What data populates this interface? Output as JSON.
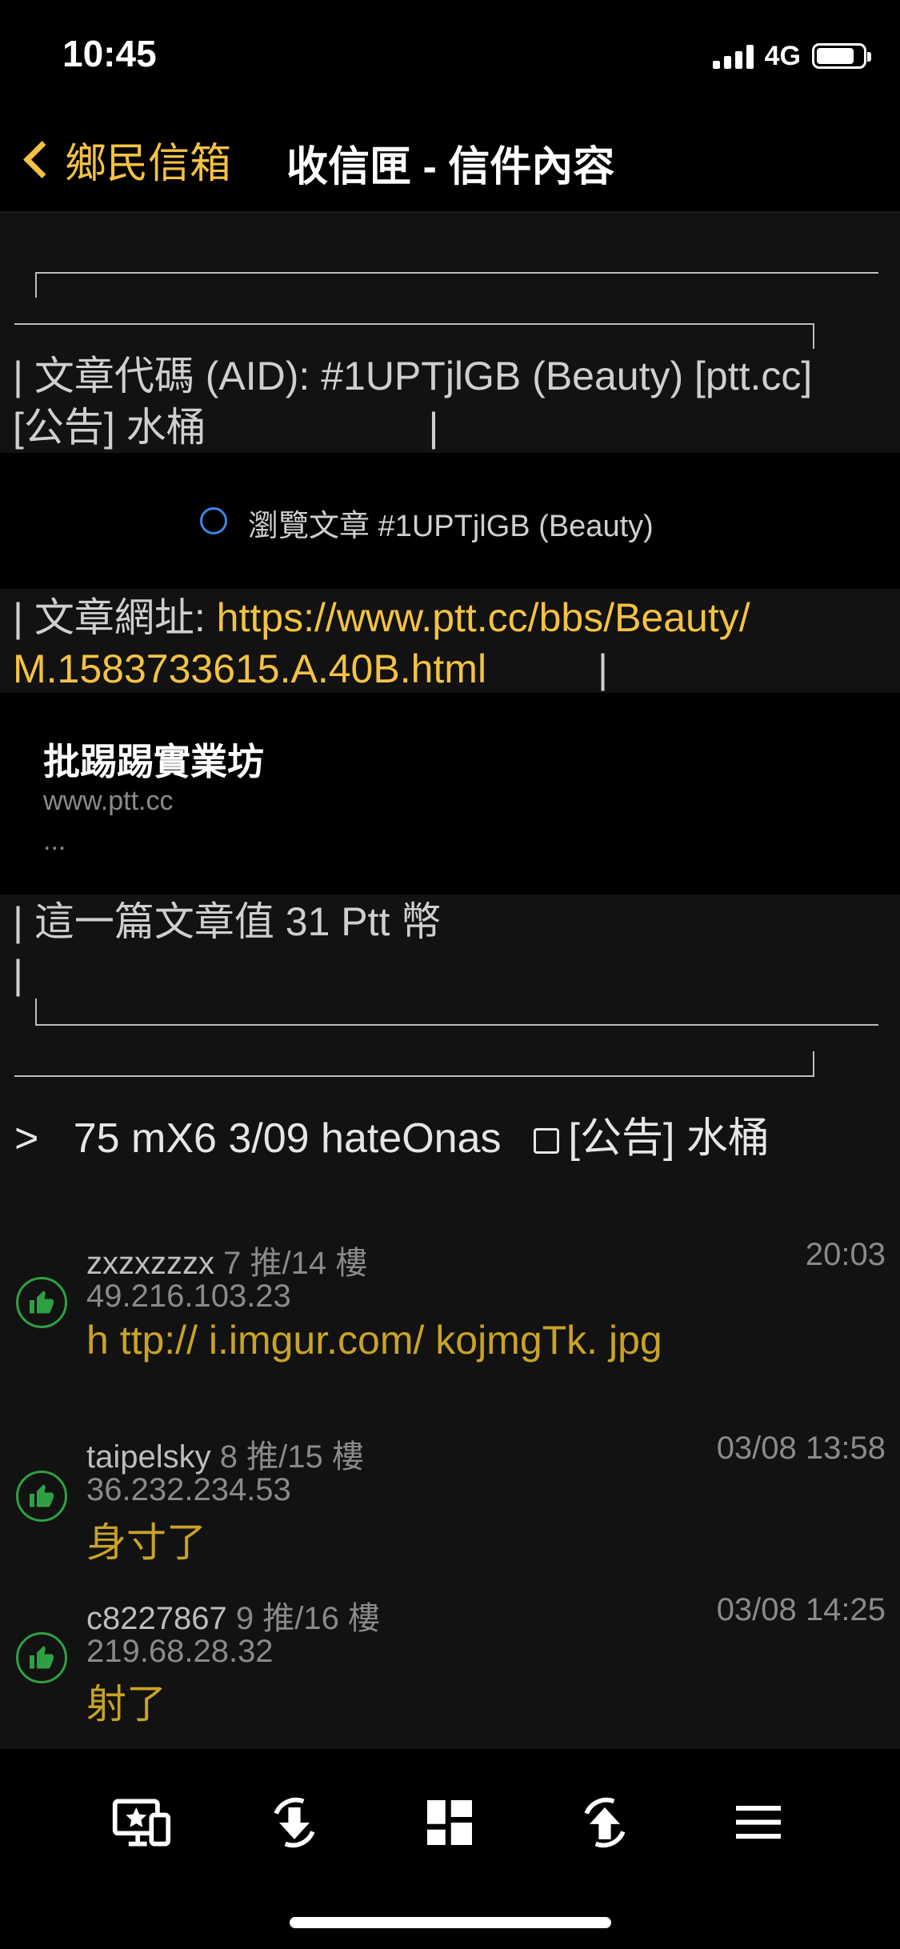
{
  "status_bar": {
    "time": "10:45",
    "network": "4G"
  },
  "nav": {
    "back_label": "鄉民信箱",
    "title": "收信匣 - 信件內容"
  },
  "post_box": {
    "aid_line": "| 文章代碼 (AID): #1UPTjlGB (Beauty) [ptt.cc]",
    "title_line": "[公告] 水桶                    |",
    "browse_label": "瀏覽文章 #1UPTjlGB (Beauty)",
    "url_prefix": "| 文章網址: ",
    "url_part1": "https://www.ptt.cc/bbs/Beauty/",
    "url_part2": "M.1583733615.A.40B.html",
    "url_suffix": "          |",
    "card_title": "批踢踢實業坊",
    "card_url": "www.ptt.cc",
    "card_desc": "...",
    "value_line": "| 這一篇文章值 31 Ptt 幣",
    "pipe_line": "|"
  },
  "mail_header": {
    "prefix": ">   75 mX6 3/09 hateOnas",
    "title": "[公告] 水桶"
  },
  "comments": [
    {
      "user": "zxzxzzzx",
      "floor": "7 推/14 樓",
      "time": "20:03",
      "ip": "49.216.103.23",
      "text": "h ttp:// i.imgur.com/ kojmgTk. jpg"
    },
    {
      "user": "taipelsky",
      "floor": "8 推/15 樓",
      "time": "03/08 13:58",
      "ip": "36.232.234.53",
      "text": "身寸了"
    },
    {
      "user": "c8227867",
      "floor": "9 推/16 樓",
      "time": "03/08 14:25",
      "ip": "219.68.28.32",
      "text": "射了"
    }
  ],
  "toolbar": {
    "items": [
      "screen-star-icon",
      "download-sync-icon",
      "grid-icon",
      "upload-sync-icon",
      "menu-icon"
    ]
  },
  "colors": {
    "accent": "#f4c243",
    "comment_text": "#c9a326",
    "thumb": "#2ea043",
    "browse_circle": "#3e87e6"
  }
}
